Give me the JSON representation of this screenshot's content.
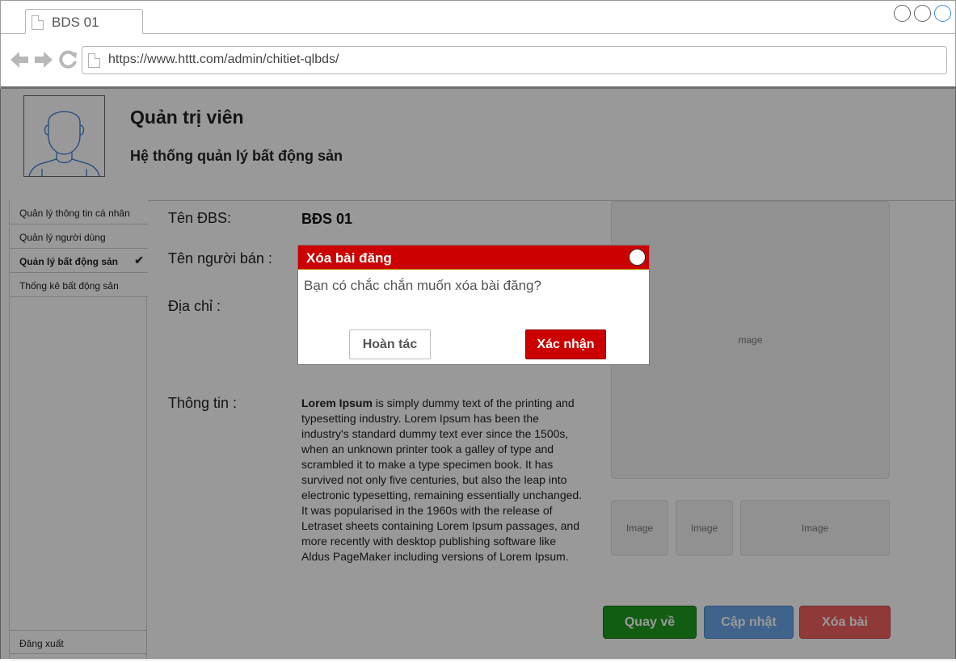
{
  "browser": {
    "tab_title": "BDS 01",
    "url": "https://www.httt.com/admin/chitiet-qlbds/"
  },
  "header": {
    "title": "Quản trị viên",
    "subtitle": "Hệ thống quản lý bất động sản"
  },
  "sidebar": {
    "items": [
      {
        "label": "Quản lý thông tin cá nhân"
      },
      {
        "label": "Quản lý người dùng"
      },
      {
        "label": "Quản lý bất động sản",
        "active": true
      },
      {
        "label": "Thống kê bất động sản"
      }
    ],
    "logout_label": "Đăng xuất"
  },
  "detail": {
    "name_label": "Tên ĐBS:",
    "name_value": "BĐS 01",
    "seller_label": "Tên người bán :",
    "address_label": "Địa chỉ :",
    "info_label": "Thông tin :",
    "info_lead": "Lorem Ipsum",
    "info_body": " is simply dummy text of the printing and typesetting industry. Lorem Ipsum has been the industry's standard dummy text ever since the 1500s, when an unknown printer took a galley of type and scrambled it to make a type specimen book. It has survived not only five centuries, but also the leap into electronic typesetting, remaining essentially unchanged. It was popularised in the 1960s with the release of Letraset sheets containing Lorem Ipsum passages, and more recently with desktop publishing software like Aldus PageMaker including versions of Lorem Ipsum."
  },
  "images": {
    "main": "mage",
    "thumbs": [
      "Image",
      "Image",
      "Image"
    ]
  },
  "actions": {
    "back": "Quay về",
    "update": "Cập nhật",
    "delete": "Xóa bài"
  },
  "dialog": {
    "title": "Xóa bài đăng",
    "message": "Bạn có chắc chắn muốn xóa bài đăng?",
    "undo": "Hoàn tác",
    "confirm": "Xác nhận"
  },
  "colors": {
    "dialog_header": "#cc0000",
    "back_button": "#1f9b1f",
    "update_button": "#6ca6e8",
    "delete_button": "#f06060"
  }
}
